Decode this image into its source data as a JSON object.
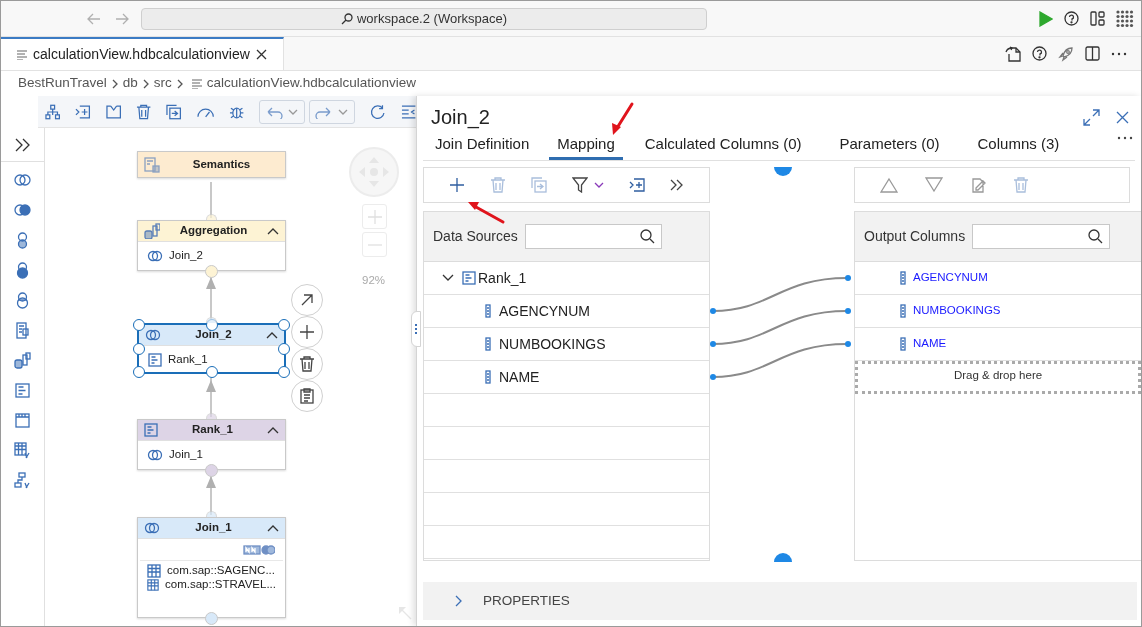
{
  "browser": {
    "address": "workspace.2 (Workspace)"
  },
  "editor_tabs": [
    {
      "label": "calculationView.hdbcalculationview",
      "selected": true
    }
  ],
  "breadcrumb": [
    "BestRunTravel",
    "db",
    "src",
    "calculationView.hdbcalculationview"
  ],
  "diagram": {
    "zoom": "92%",
    "nodes": [
      {
        "title": "Semantics",
        "kind": "semantics",
        "color": "#fdebd0",
        "selected": false
      },
      {
        "title": "Aggregation",
        "kind": "aggregation",
        "color": "#fdf3d4",
        "selected": false,
        "items": [
          {
            "label": "Join_2",
            "kind": "join"
          }
        ]
      },
      {
        "title": "Join_2",
        "kind": "join",
        "color": "#d8e9f9",
        "selected": true,
        "items": [
          {
            "label": "Rank_1",
            "kind": "rank"
          }
        ]
      },
      {
        "title": "Rank_1",
        "kind": "rank",
        "color": "#ddd4e6",
        "selected": false,
        "items": [
          {
            "label": "Join_1",
            "kind": "join"
          }
        ]
      },
      {
        "title": "Join_1",
        "kind": "join",
        "color": "#d8e9f9",
        "selected": false,
        "items": [
          {
            "label": "com.sap::SAGENC...",
            "kind": "table"
          },
          {
            "label": "com.sap::STRAVEL...",
            "kind": "table"
          }
        ]
      }
    ]
  },
  "panel": {
    "title": "Join_2",
    "tabs": [
      {
        "label": "Join Definition",
        "selected": false
      },
      {
        "label": "Mapping",
        "selected": true
      },
      {
        "label": "Calculated Columns (0)",
        "selected": false
      },
      {
        "label": "Parameters (0)",
        "selected": false
      },
      {
        "label": "Columns (3)",
        "selected": false
      }
    ],
    "sources_label": "Data Sources",
    "source": {
      "name": "Rank_1",
      "expanded": true,
      "children": [
        {
          "name": "AGENCYNUM",
          "mapped": true
        },
        {
          "name": "NUMBOOKINGS",
          "mapped": true
        },
        {
          "name": "NAME",
          "mapped": true
        }
      ]
    },
    "outputs_label": "Output Columns",
    "outputs": [
      {
        "name": "AGENCYNUM"
      },
      {
        "name": "NUMBOOKINGS"
      },
      {
        "name": "NAME"
      }
    ],
    "drop_hint": "Drag & drop here",
    "properties": {
      "label": "PROPERTIES",
      "expanded": false
    }
  }
}
